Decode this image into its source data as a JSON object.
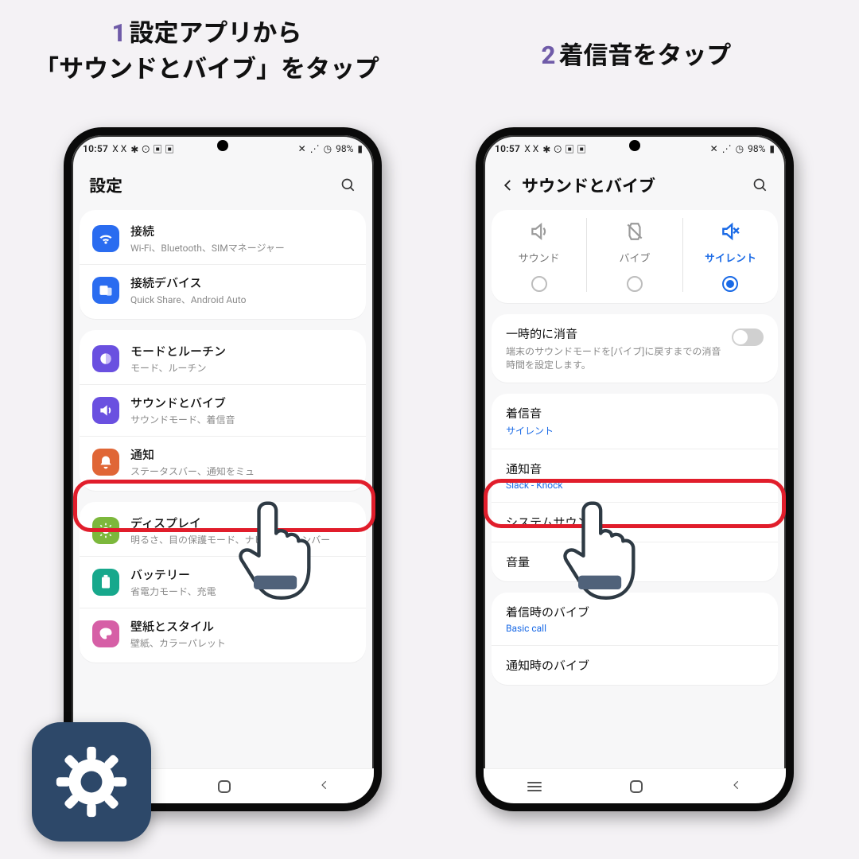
{
  "caption1_num": "1",
  "caption1_text": "設定アプリから\n「サウンドとバイブ」をタップ",
  "caption2_num": "2",
  "caption2_text": "着信音をタップ",
  "status": {
    "time": "10:57",
    "battery": "98%"
  },
  "left": {
    "title": "設定",
    "groups": [
      [
        {
          "icon": "wifi",
          "color": "#2a6cf0",
          "title": "接続",
          "sub": "Wi-Fi、Bluetooth、SIMマネージャー"
        },
        {
          "icon": "device",
          "color": "#2a6cf0",
          "title": "接続デバイス",
          "sub": "Quick Share、Android Auto"
        }
      ],
      [
        {
          "icon": "modes",
          "color": "#6a50e0",
          "title": "モードとルーチン",
          "sub": "モード、ルーチン"
        },
        {
          "icon": "sound",
          "color": "#6a50e0",
          "title": "サウンドとバイブ",
          "sub": "サウンドモード、着信音"
        },
        {
          "icon": "bell",
          "color": "#e06636",
          "title": "通知",
          "sub": "ステータスバー、通知をミュ"
        }
      ],
      [
        {
          "icon": "display",
          "color": "#7cb83c",
          "title": "ディスプレイ",
          "sub": "明るさ、目の保護モード、ナビゲーションバー"
        },
        {
          "icon": "battery",
          "color": "#17a88c",
          "title": "バッテリー",
          "sub": "省電力モード、充電"
        },
        {
          "icon": "style",
          "color": "#d65fa6",
          "title": "壁紙とスタイル",
          "sub": "壁紙、カラーパレット"
        }
      ]
    ]
  },
  "right": {
    "title": "サウンドとバイブ",
    "modes": [
      {
        "label": "サウンド",
        "sel": false
      },
      {
        "label": "バイブ",
        "sel": false
      },
      {
        "label": "サイレント",
        "sel": true
      }
    ],
    "mute": {
      "title": "一時的に消音",
      "sub": "端末のサウンドモードを[バイブ]に戻すまでの消音時間を設定します。"
    },
    "sound_items": [
      {
        "title": "着信音",
        "sub": "サイレント",
        "blue": true
      },
      {
        "title": "通知音",
        "sub": "Slack - Knock ",
        "blue": true
      },
      {
        "title": "システムサウンド",
        "sub": "",
        "blue": false
      },
      {
        "title": "音量",
        "sub": "",
        "blue": false
      }
    ],
    "vib_items": [
      {
        "title": "着信時のバイブ",
        "sub": "Basic call",
        "blue": true
      },
      {
        "title": "通知時のバイブ",
        "sub": "",
        "blue": true
      }
    ]
  }
}
